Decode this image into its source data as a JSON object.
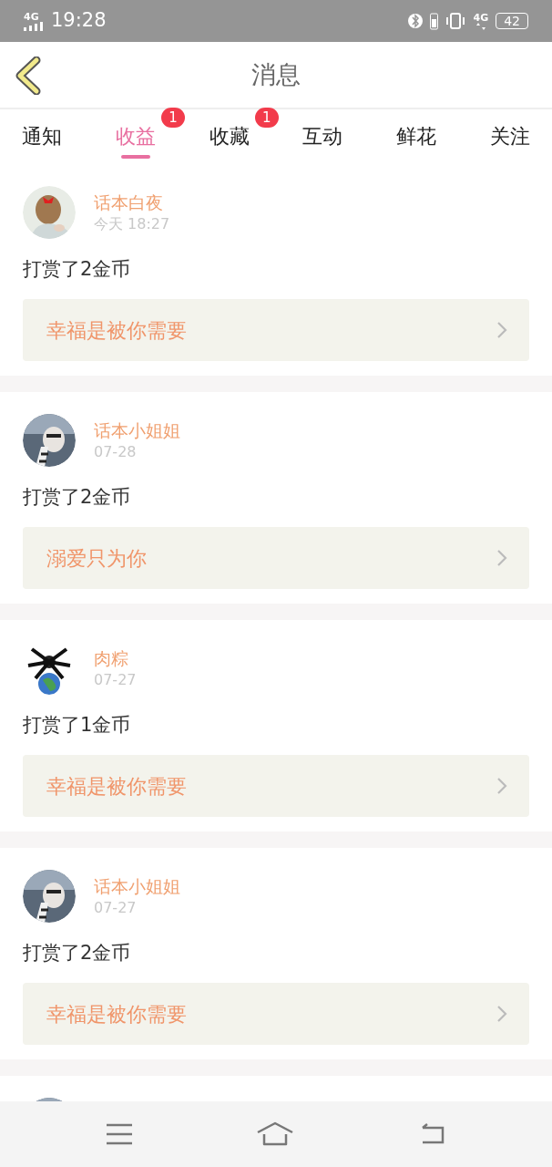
{
  "status_bar": {
    "network": "4G",
    "time": "19:28",
    "data_network": "4G",
    "battery": "42"
  },
  "header": {
    "title": "消息"
  },
  "tabs": [
    {
      "label": "通知",
      "selected": false
    },
    {
      "label": "收益",
      "selected": true,
      "badge": "1"
    },
    {
      "label": "收藏",
      "selected": false,
      "badge": "1"
    },
    {
      "label": "互动",
      "selected": false
    },
    {
      "label": "鲜花",
      "selected": false
    },
    {
      "label": "关注",
      "selected": false
    }
  ],
  "messages": [
    {
      "avatar": {
        "kind": "picture"
      },
      "name": "话本白夜",
      "time": "今天 18:27",
      "text": "打赏了2金币",
      "work": "幸福是被你需要"
    },
    {
      "avatar": {
        "kind": "picture"
      },
      "name": "话本小姐姐",
      "time": "07-28",
      "text": "打赏了2金币",
      "work": "溺爱只为你"
    },
    {
      "avatar": {
        "kind": "picture"
      },
      "name": "肉粽",
      "time": "07-27",
      "text": "打赏了1金币",
      "work": "幸福是被你需要"
    },
    {
      "avatar": {
        "kind": "picture"
      },
      "name": "话本小姐姐",
      "time": "07-27",
      "text": "打赏了2金币",
      "work": "幸福是被你需要"
    },
    {
      "avatar": {
        "kind": "picture"
      }
    }
  ]
}
